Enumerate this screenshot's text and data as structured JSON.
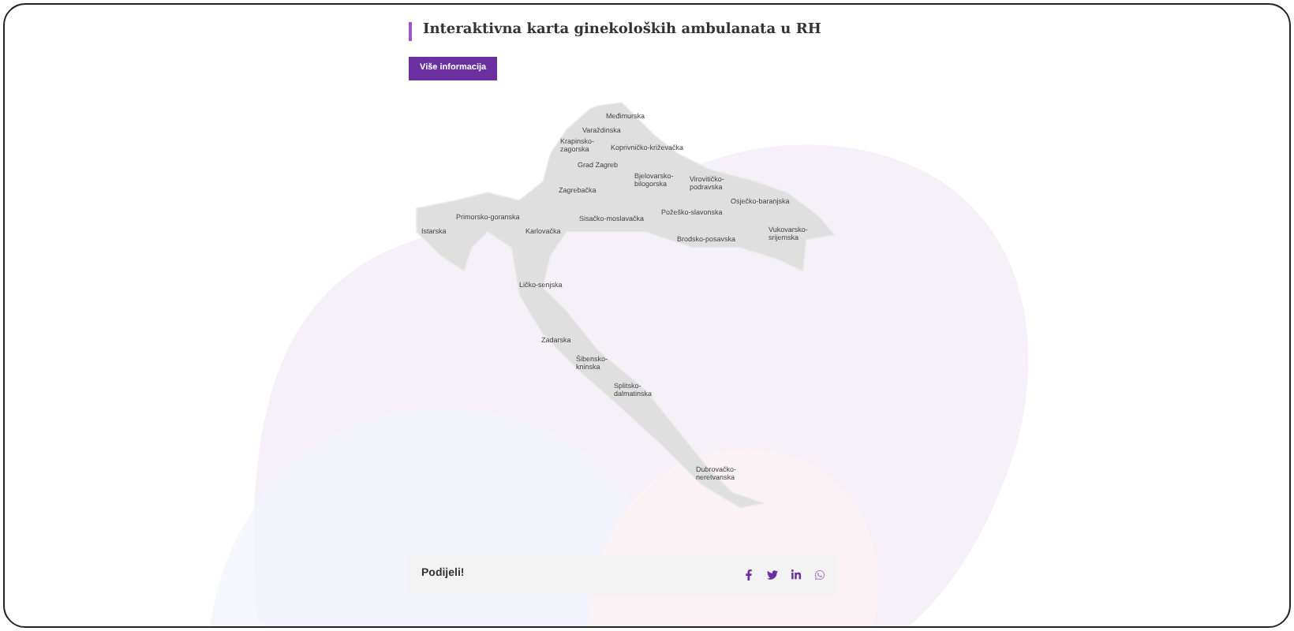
{
  "header": {
    "title": "Interaktivna karta ginekoloških ambulanata u RH",
    "button": "Više informacija"
  },
  "map": {
    "regions": [
      {
        "label": "Međimurska"
      },
      {
        "label": "Varaždinska"
      },
      {
        "label": "Krapinsko-zagorska"
      },
      {
        "label": "Koprivničko-križevačka"
      },
      {
        "label": "Grad Zagreb"
      },
      {
        "label": "Zagrebačka"
      },
      {
        "label": "Bjelovarsko-bilogorska"
      },
      {
        "label": "Virovitičko-podravska"
      },
      {
        "label": "Osječko-baranjska"
      },
      {
        "label": "Primorsko-goranska"
      },
      {
        "label": "Sisačko-moslavačka"
      },
      {
        "label": "Požeško-slavonska"
      },
      {
        "label": "Istarska"
      },
      {
        "label": "Karlovačka"
      },
      {
        "label": "Brodsko-posavska"
      },
      {
        "label": "Vukovarsko-srijemska"
      },
      {
        "label": "Ličko-senjska"
      },
      {
        "label": "Zadarska"
      },
      {
        "label": "Šibensko-kninska"
      },
      {
        "label": "Splitsko-dalmatinska"
      },
      {
        "label": "Dubrovačko-neretvanska"
      }
    ]
  },
  "share": {
    "label": "Podijeli!"
  }
}
